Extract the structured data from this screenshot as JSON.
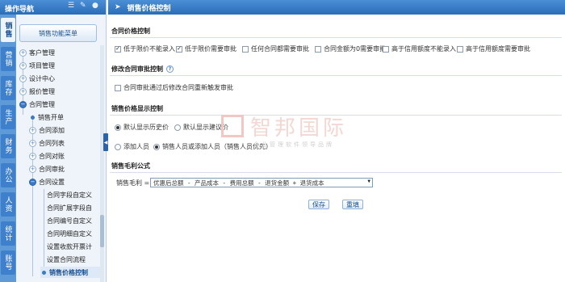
{
  "nav": {
    "header": "操作导航",
    "menu_button": "销售功能菜单",
    "tabs": [
      "销售",
      "营销",
      "库存",
      "生产",
      "财务",
      "办公",
      "人资",
      "统计",
      "账号"
    ],
    "tree": [
      {
        "label": "客户管理"
      },
      {
        "label": "项目管理"
      },
      {
        "label": "设计中心"
      },
      {
        "label": "报价管理"
      },
      {
        "label": "合同管理"
      },
      {
        "label": "销售开单"
      },
      {
        "label": "合同添加"
      },
      {
        "label": "合同列表"
      },
      {
        "label": "合同对账"
      },
      {
        "label": "合同审批"
      },
      {
        "label": "合同设置"
      },
      {
        "label": "合同字段自定义"
      },
      {
        "label": "合同扩展字段自"
      },
      {
        "label": "合同编号自定义"
      },
      {
        "label": "合同明细自定义"
      },
      {
        "label": "设置收款开票计"
      },
      {
        "label": "设置合同流程"
      },
      {
        "label": "销售价格控制"
      }
    ]
  },
  "main": {
    "title": "销售价格控制",
    "sec1": {
      "title": "合同价格控制",
      "options": [
        "低于限价不能录入",
        "低于限价需要审批",
        "任何合同都需要审批",
        "合同金额为0需要审批",
        "高于信用额度不能录入",
        "高于信用额度需要审批"
      ]
    },
    "sec2": {
      "title": "修改合同审批控制",
      "option": "合同审批通过后修改合同重新触发审批"
    },
    "sec3": {
      "title": "销售价格显示控制",
      "opt1": "默认显示历史价",
      "opt2": "默认显示建议价",
      "opt3": "添加人员",
      "opt4": "销售人员或添加人员（销售人员优先）"
    },
    "sec4": {
      "title": "销售毛利公式",
      "label": "销售毛利 =",
      "formula": "优惠后总额 - 产品成本 - 费用总额 - 退货金额 + 退货成本"
    },
    "save": "保存",
    "reset": "重填"
  },
  "watermark": {
    "name": "智邦国际",
    "slogan": "企业管理软件领导品牌"
  }
}
